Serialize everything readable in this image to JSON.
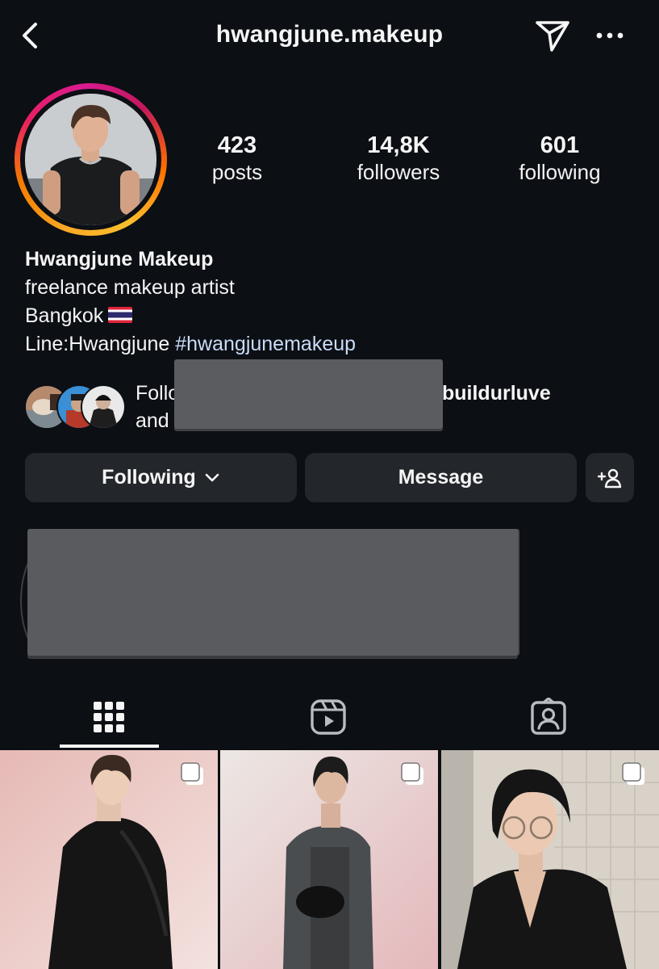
{
  "header": {
    "username": "hwangjune.makeup",
    "icons": [
      "back-icon",
      "send-icon",
      "more-icon"
    ]
  },
  "stats": {
    "posts_count": "423",
    "posts_label": "posts",
    "followers_count": "14,8K",
    "followers_label": "followers",
    "following_count": "601",
    "following_label": "following"
  },
  "bio": {
    "name": "Hwangjune Makeup",
    "line1": "freelance makeup artist",
    "line2": "Bangkok",
    "line3_prefix": "Line:Hwangjune ",
    "hashtag": "#hwangjunemakeup"
  },
  "followed_by": {
    "line1_start": "Follo",
    "line1_end": "buildurluve",
    "line2_start": "and"
  },
  "actions": {
    "following_label": "Following",
    "message_label": "Message"
  },
  "tabs": [
    "grid-icon",
    "reels-icon",
    "tagged-icon"
  ],
  "colors": {
    "background": "#0c0f14",
    "button": "#23262b",
    "hashtag": "#c9dcf7",
    "story_ring": [
      "#f9a825",
      "#e91e63"
    ]
  }
}
